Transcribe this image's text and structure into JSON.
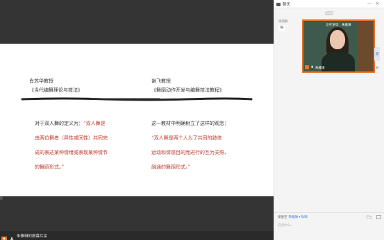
{
  "chat": {
    "title": "聊天",
    "time_chip": "10:24",
    "sender": "杨丽敏",
    "message": "好",
    "video_status": "正在讲话：朱雅琳",
    "video_name": "朱雅琳",
    "side_tab": "成员",
    "send_label": "发送至",
    "send_target": "朱雅琳 ▾ 私聊",
    "input_placeholder": "说点什么..."
  },
  "slide": {
    "left_author": "肖苏华教授",
    "left_book": "《当代编舞理论与技法》",
    "right_author": "谢飞教授",
    "right_book": "《舞蹈动作开发与编舞技法教程》",
    "left_lines": [
      {
        "a": "对于双人舞的定义为：",
        "b": "“双人舞是"
      },
      {
        "a": "",
        "b": "由两位舞者（异性或同性）共同完"
      },
      {
        "a": "",
        "b": "成的表达某种情绪或表现某种情节"
      },
      {
        "a": "",
        "b": "的舞蹈形式。”"
      }
    ],
    "right_lines": [
      {
        "a": "这一教材中明确树立了这样的观念：",
        "b": ""
      },
      {
        "a": "",
        "b": "“双人舞是两个人为了共同的肢体"
      },
      {
        "a": "",
        "b": "运动和情感目的而进行的互为关照、"
      },
      {
        "a": "",
        "b": "融通的舞蹈形式。”"
      }
    ]
  },
  "bottom_bar": {
    "label": "朱雅琳的屏幕共享"
  }
}
